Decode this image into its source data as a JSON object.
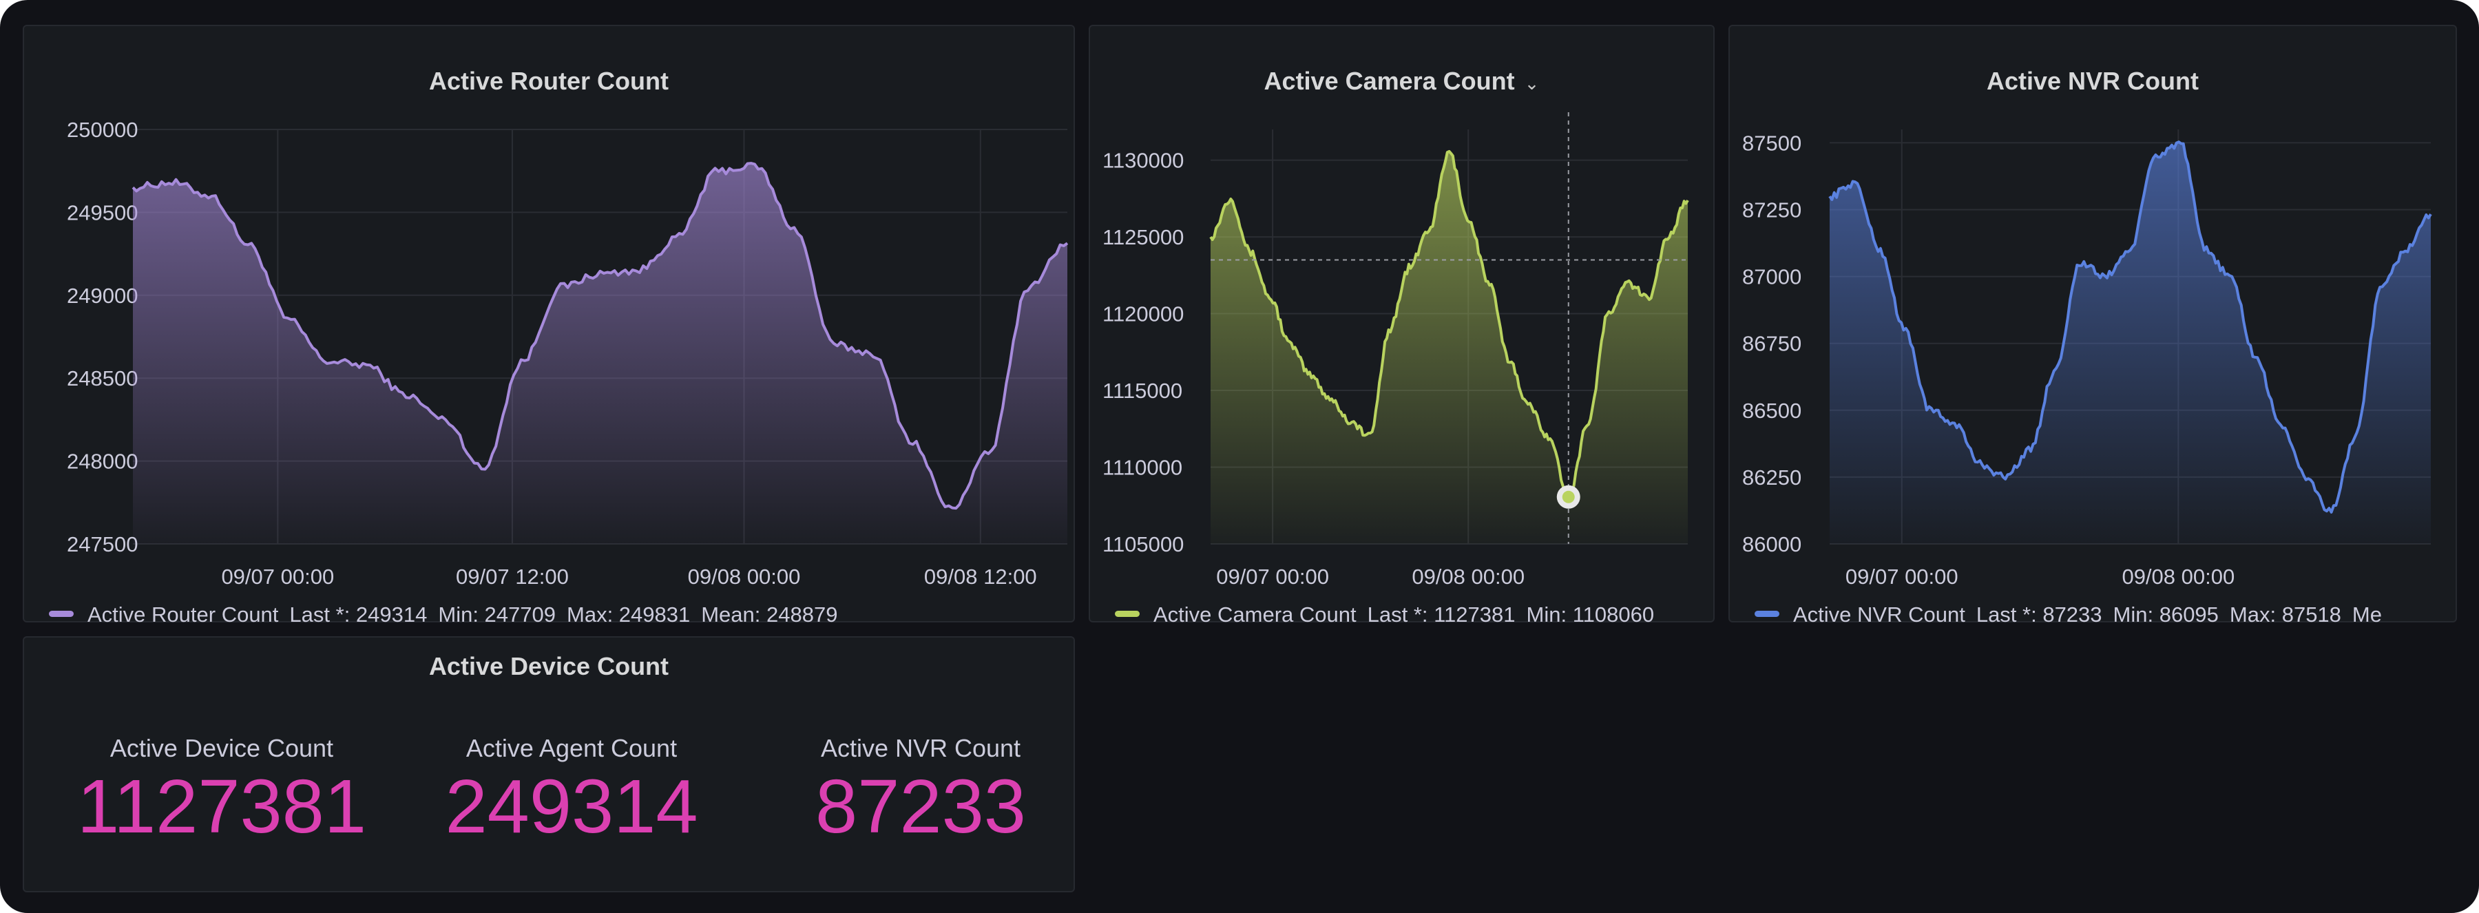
{
  "colors": {
    "router": "#a78bdb",
    "camera": "#b9d35f",
    "nvr": "#5b82e0",
    "stat_value": "#db40b1"
  },
  "router_panel": {
    "title": "Active Router Count",
    "y_ticks": [
      "250000",
      "249500",
      "249000",
      "248500",
      "248000",
      "247500"
    ],
    "x_ticks": [
      "09/07 00:00",
      "09/07 12:00",
      "09/08 00:00",
      "09/08 12:00"
    ],
    "legend": {
      "series": "Active Router Count",
      "last": "Last *: 249314",
      "min": "Min: 247709",
      "max": "Max: 249831",
      "mean": "Mean: 248879"
    }
  },
  "camera_panel": {
    "title": "Active Camera Count",
    "chevron_icon": "chevron-down-icon",
    "y_ticks": [
      "1130000",
      "1125000",
      "1120000",
      "1115000",
      "1110000",
      "1105000"
    ],
    "x_ticks": [
      "09/07 00:00",
      "09/08 00:00"
    ],
    "legend": {
      "series": "Active Camera Count",
      "last": "Last *: 1127381",
      "min": "Min: 1108060"
    }
  },
  "nvr_panel": {
    "title": "Active NVR Count",
    "y_ticks": [
      "87500",
      "87250",
      "87000",
      "86750",
      "86500",
      "86250",
      "86000"
    ],
    "x_ticks": [
      "09/07 00:00",
      "09/08 00:00"
    ],
    "legend": {
      "series": "Active NVR Count",
      "last": "Last *: 87233",
      "min": "Min: 86095",
      "max": "Max: 87518",
      "mean": "Me"
    }
  },
  "device_panel": {
    "title": "Active Device Count",
    "stats": [
      {
        "label": "Active Device Count",
        "value": "1127381"
      },
      {
        "label": "Active Agent Count",
        "value": "249314"
      },
      {
        "label": "Active NVR Count",
        "value": "87233"
      }
    ]
  },
  "chart_data": [
    {
      "type": "area",
      "title": "Active Router Count",
      "x": [
        "09/06 14:00",
        "09/06 16:00",
        "09/06 18:00",
        "09/06 20:00",
        "09/06 22:00",
        "09/07 00:00",
        "09/07 02:00",
        "09/07 04:00",
        "09/07 06:00",
        "09/07 08:00",
        "09/07 10:00",
        "09/07 12:00",
        "09/07 14:00",
        "09/07 16:00",
        "09/07 18:00",
        "09/07 20:00",
        "09/07 22:00",
        "09/08 00:00",
        "09/08 02:00",
        "09/08 04:00",
        "09/08 06:00",
        "09/08 08:00",
        "09/08 10:00",
        "09/08 12:00",
        "09/08 14:00"
      ],
      "series": [
        {
          "name": "Active Router Count",
          "values": [
            249650,
            249680,
            249600,
            249300,
            248850,
            248600,
            248580,
            248400,
            248250,
            247950,
            248600,
            249050,
            249130,
            249150,
            249350,
            249750,
            249780,
            249400,
            248700,
            248650,
            248120,
            247709,
            248050,
            249050,
            249314
          ]
        }
      ],
      "ylim": [
        247500,
        250000
      ],
      "x_ticks": [
        "09/07 00:00",
        "09/07 12:00",
        "09/08 00:00",
        "09/08 12:00"
      ],
      "grid": true,
      "legend": "bottom"
    },
    {
      "type": "area",
      "title": "Active Camera Count",
      "x": [
        "09/06 14:00",
        "09/06 16:00",
        "09/06 18:00",
        "09/06 20:00",
        "09/06 22:00",
        "09/07 00:00",
        "09/07 02:00",
        "09/07 04:00",
        "09/07 06:00",
        "09/07 08:00",
        "09/07 10:00",
        "09/07 12:00",
        "09/07 14:00",
        "09/07 16:00",
        "09/07 18:00",
        "09/07 20:00",
        "09/07 22:00",
        "09/08 00:00",
        "09/08 02:00",
        "09/08 04:00",
        "09/08 06:00",
        "09/08 08:00",
        "09/08 10:00",
        "09/08 12:00",
        "09/08 14:00"
      ],
      "series": [
        {
          "name": "Active Camera Count",
          "values": [
            1125000,
            1127500,
            1124000,
            1121000,
            1118000,
            1116000,
            1114500,
            1113000,
            1112000,
            1119000,
            1123000,
            1125500,
            1130500,
            1126000,
            1122000,
            1117000,
            1114000,
            1112000,
            1108060,
            1113000,
            1120000,
            1122000,
            1121000,
            1125000,
            1127381
          ]
        }
      ],
      "ylim": [
        1105000,
        1132000
      ],
      "x_ticks": [
        "09/07 00:00",
        "09/08 00:00"
      ],
      "grid": true,
      "legend": "bottom",
      "hover_crosshair": {
        "x": "09/08 02:00",
        "y": 1123500
      }
    },
    {
      "type": "area",
      "title": "Active NVR Count",
      "x": [
        "09/06 14:00",
        "09/06 16:00",
        "09/06 18:00",
        "09/06 20:00",
        "09/06 22:00",
        "09/07 00:00",
        "09/07 02:00",
        "09/07 04:00",
        "09/07 06:00",
        "09/07 08:00",
        "09/07 10:00",
        "09/07 12:00",
        "09/07 14:00",
        "09/07 16:00",
        "09/07 18:00",
        "09/07 20:00",
        "09/07 22:00",
        "09/08 00:00",
        "09/08 02:00",
        "09/08 04:00",
        "09/08 06:00",
        "09/08 08:00",
        "09/08 10:00",
        "09/08 12:00",
        "09/08 14:00"
      ],
      "series": [
        {
          "name": "Active NVR Count",
          "values": [
            87300,
            87350,
            87100,
            86800,
            86500,
            86450,
            86300,
            86250,
            86350,
            86650,
            87050,
            87000,
            87100,
            87450,
            87500,
            87100,
            87000,
            86700,
            86450,
            86250,
            86120,
            86400,
            86950,
            87100,
            87233
          ]
        }
      ],
      "ylim": [
        86000,
        87550
      ],
      "x_ticks": [
        "09/07 00:00",
        "09/08 00:00"
      ],
      "grid": true,
      "legend": "bottom"
    }
  ]
}
